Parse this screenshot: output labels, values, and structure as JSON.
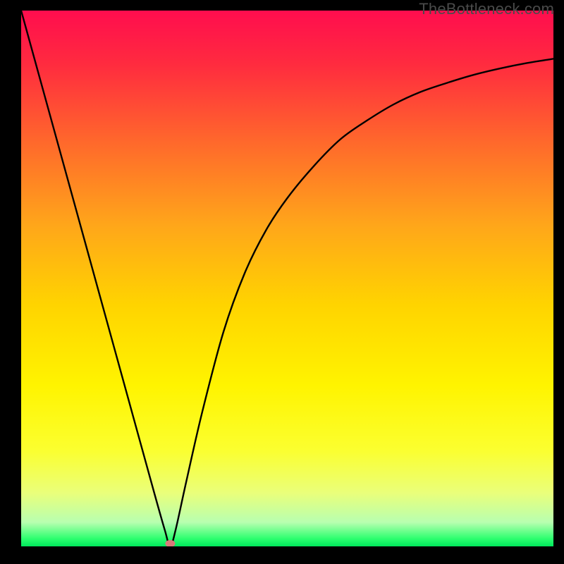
{
  "watermark": "TheBottleneck.com",
  "chart_data": {
    "type": "line",
    "title": "",
    "xlabel": "",
    "ylabel": "",
    "xlim": [
      0,
      100
    ],
    "ylim": [
      0,
      100
    ],
    "x_min_point": 28,
    "series": [
      {
        "name": "curve",
        "x": [
          0,
          5,
          10,
          15,
          20,
          25,
          27,
          28,
          29,
          31,
          34,
          38,
          42,
          46,
          50,
          55,
          60,
          65,
          70,
          75,
          80,
          85,
          90,
          95,
          100
        ],
        "y": [
          100,
          82,
          64,
          46,
          28,
          10,
          3,
          0,
          3,
          12,
          25,
          40,
          51,
          59,
          65,
          71,
          76,
          79.5,
          82.5,
          84.8,
          86.5,
          88,
          89.2,
          90.2,
          91
        ]
      }
    ],
    "gradient_stops": [
      {
        "offset": 0.0,
        "color": "#ff0d4e"
      },
      {
        "offset": 0.1,
        "color": "#ff2b3f"
      },
      {
        "offset": 0.25,
        "color": "#ff6a2b"
      },
      {
        "offset": 0.4,
        "color": "#ffa61a"
      },
      {
        "offset": 0.55,
        "color": "#ffd400"
      },
      {
        "offset": 0.7,
        "color": "#fff400"
      },
      {
        "offset": 0.82,
        "color": "#fbff2f"
      },
      {
        "offset": 0.9,
        "color": "#eaff7a"
      },
      {
        "offset": 0.955,
        "color": "#b8ffb0"
      },
      {
        "offset": 0.985,
        "color": "#2fff70"
      },
      {
        "offset": 1.0,
        "color": "#00e85c"
      }
    ],
    "marker": {
      "x": 28,
      "y": 0,
      "color": "#d97a7a"
    }
  }
}
